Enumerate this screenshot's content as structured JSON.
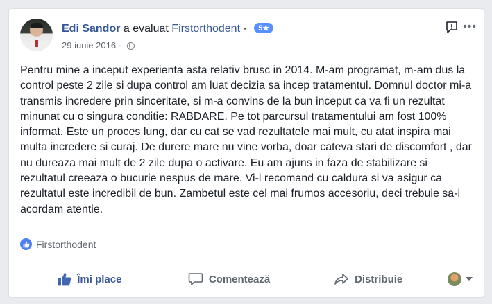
{
  "post": {
    "author": "Edi Sandor",
    "action": "a evaluat",
    "target": "Firstorthodent",
    "separator": "-",
    "rating": "5★",
    "date": "29 iunie 2016",
    "date_separator": "·",
    "privacy_icon": "globe-icon",
    "text": "Pentru mine a inceput experienta asta relativ brusc in 2014. M-am programat, m-am dus la control peste 2 zile si dupa control am luat decizia sa incep tratamentul. Domnul doctor mi-a transmis incredere prin sinceritate, si m-a convins de la bun inceput ca va fi un rezultat minunat cu o singura conditie: RABDARE. Pe tot parcursul tratamentului am fost 100% informat. Este un proces lung, dar cu cat se vad rezultatele mai mult, cu atat inspira mai multa incredere si curaj. De durere mare nu vine vorba, doar cateva stari de discomfort , dar nu dureaza mai mult de 2 zile dupa o activare. Eu am ajuns in faza de stabilizare si rezultatul creeaza o bucurie nespus de mare. Vi-l recomand cu caldura si va asigur ca rezultatul este incredibil de bun. Zambetul este cel mai frumos accesoriu, deci trebuie sa-i acordam atentie."
  },
  "reactions": {
    "icon": "like-icon",
    "label": "Firstorthodent"
  },
  "actions": {
    "like_label": "Îmi place",
    "comment_label": "Comentează",
    "share_label": "Distribuie"
  },
  "colors": {
    "link": "#365899",
    "like_active": "#385898",
    "badge": "#5890ff"
  }
}
